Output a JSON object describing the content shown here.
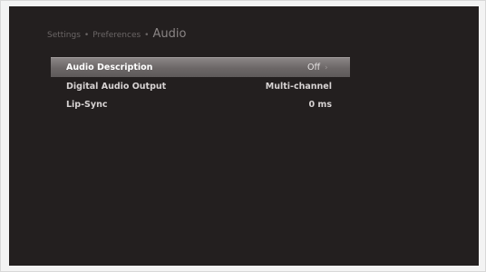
{
  "breadcrumb": {
    "items": [
      "Settings",
      "Preferences"
    ],
    "separator": "•",
    "current": "Audio"
  },
  "menu": {
    "selected_index": 0,
    "items": [
      {
        "label": "Audio Description",
        "value": "Off",
        "icon": "chevron-right-icon"
      },
      {
        "label": "Digital Audio Output",
        "value": "Multi-channel"
      },
      {
        "label": "Lip-Sync",
        "value": "0 ms"
      }
    ]
  },
  "colors": {
    "background": "#231f1f",
    "highlight": "#7a7575",
    "text": "#d7d3d3"
  }
}
